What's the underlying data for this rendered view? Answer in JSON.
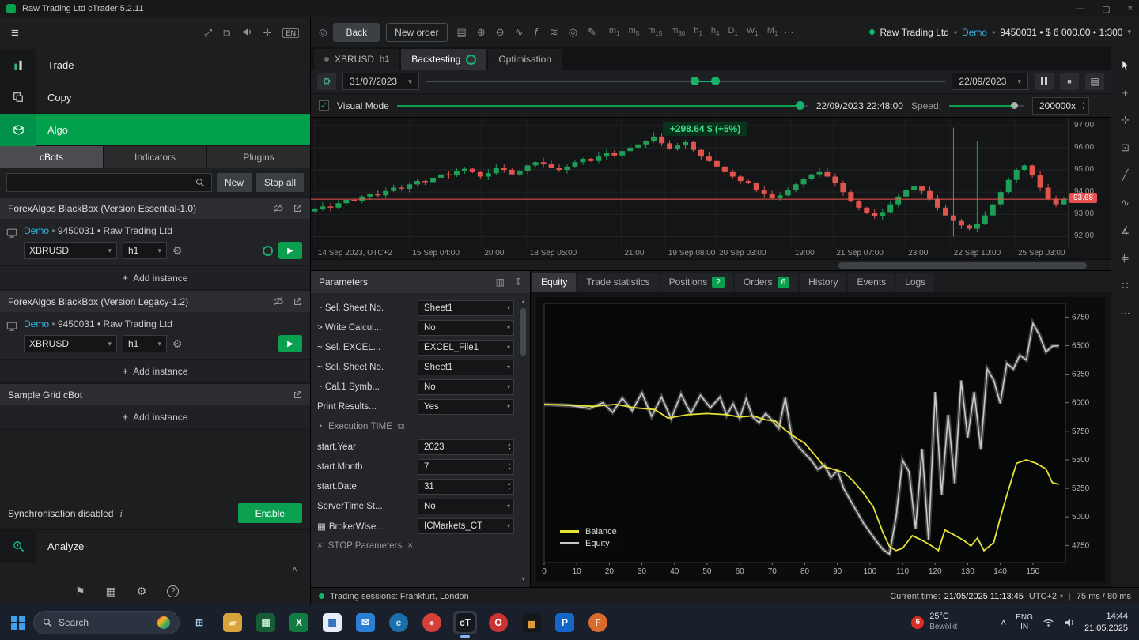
{
  "titlebar": {
    "title": "Raw Trading Ltd cTrader 5.2.11"
  },
  "sidebar": {
    "top_icons": [
      {
        "name": "fit-window-icon",
        "glyph": "⤢"
      },
      {
        "name": "windows-layout-icon",
        "glyph": "⧉"
      },
      {
        "name": "speaker-icon",
        "glyph": "speaker"
      },
      {
        "name": "widgets-icon",
        "glyph": "✛"
      },
      {
        "name": "language-badge",
        "glyph": "EN"
      }
    ],
    "nav": [
      {
        "label": "Trade"
      },
      {
        "label": "Copy"
      },
      {
        "label": "Algo"
      }
    ],
    "tabs": [
      {
        "label": "cBots",
        "active": true
      },
      {
        "label": "Indicators",
        "active": false
      },
      {
        "label": "Plugins",
        "active": false
      }
    ],
    "actions": {
      "new": "New",
      "stop_all": "Stop all"
    },
    "bots": [
      {
        "name": "ForexAlgos BlackBox (Version Essential-1.0)",
        "icons": [
          "cloud-off-icon",
          "share-icon"
        ],
        "instances": [
          {
            "account_type": "Demo",
            "account_rest": "9450031 • Raw Trading Ltd",
            "symbol": "XBRUSD",
            "timeframe": "h1",
            "running": true
          }
        ],
        "add_label": "Add instance"
      },
      {
        "name": "ForexAlgos BlackBox (Version Legacy-1.2)",
        "icons": [
          "cloud-off-icon",
          "share-icon"
        ],
        "instances": [
          {
            "account_type": "Demo",
            "account_rest": "9450031 • Raw Trading Ltd",
            "symbol": "XBRUSD",
            "timeframe": "h1",
            "running": false
          }
        ],
        "add_label": "Add instance"
      },
      {
        "name": "Sample Grid cBot",
        "icons": [
          "share-icon"
        ],
        "instances": [],
        "add_label": "Add instance"
      }
    ],
    "sync": {
      "label": "Synchronisation disabled",
      "button": "Enable"
    },
    "analyze": {
      "label": "Analyze"
    },
    "bottom_icons": [
      {
        "name": "alerts-icon",
        "glyph": "⚑"
      },
      {
        "name": "economic-calendar-icon",
        "glyph": "▦"
      },
      {
        "name": "settings-icon",
        "glyph": "⚙"
      },
      {
        "name": "help-icon",
        "glyph": "?"
      }
    ]
  },
  "toolbar": {
    "back": "Back",
    "new_order": "New order",
    "icons": [
      {
        "name": "chart-layout-icon",
        "glyph": "▤"
      },
      {
        "name": "zoom-in-icon",
        "glyph": "⊕"
      },
      {
        "name": "zoom-out-icon",
        "glyph": "⊖"
      },
      {
        "name": "tick-volume-icon",
        "glyph": "∿"
      },
      {
        "name": "indicators-icon",
        "glyph": "ƒ"
      },
      {
        "name": "objects-icon",
        "glyph": "≋"
      },
      {
        "name": "visibility-icon",
        "glyph": "◎"
      },
      {
        "name": "edit-chart-icon",
        "glyph": "✎"
      }
    ],
    "timeframes": [
      [
        "m",
        "1"
      ],
      [
        "m",
        "5"
      ],
      [
        "m",
        "15"
      ],
      [
        "m",
        "30"
      ],
      [
        "h",
        "1"
      ],
      [
        "h",
        "4"
      ],
      [
        "D",
        "1"
      ],
      [
        "W",
        "1"
      ],
      [
        "M",
        "1"
      ]
    ],
    "more": "⋯",
    "account": {
      "name": "Raw Trading Ltd",
      "type": "Demo",
      "rest": "9450031 • $ 6 000.00 • 1:300"
    }
  },
  "doc_tabs": {
    "symbol_tab": {
      "label": "XBRUSD",
      "tf": "h1"
    },
    "backtesting": "Backtesting",
    "optimisation": "Optimisation"
  },
  "backtest": {
    "start_date": "31/07/2023",
    "end_date": "22/09/2023",
    "progress_a": 51,
    "progress_b": 55
  },
  "visual": {
    "label": "Visual Mode",
    "checked": true,
    "datetime": "22/09/2023 22:48:00",
    "speed_label": "Speed:",
    "speed_value": "200000x",
    "position_pct": 97,
    "speed_pct": 82
  },
  "chart_data": [
    {
      "type": "candlestick",
      "symbol": "XBRUSD",
      "timeframe": "h1",
      "pl_label": "+298.64 $ (+5%)",
      "current_price": 93.68,
      "y_ticks": [
        97,
        96,
        95,
        94,
        93,
        92
      ],
      "x_labels": [
        {
          "t": "14 Sep 2023, UTC+2",
          "p": 0.005
        },
        {
          "t": "15 Sep 04:00",
          "p": 0.13
        },
        {
          "t": "20:00",
          "p": 0.225
        },
        {
          "t": "18 Sep 05:00",
          "p": 0.285
        },
        {
          "t": "21:00",
          "p": 0.41
        },
        {
          "t": "19 Sep 08:00",
          "p": 0.468
        },
        {
          "t": "20 Sep 03:00",
          "p": 0.535
        },
        {
          "t": "19:00",
          "p": 0.635
        },
        {
          "t": "21 Sep 07:00",
          "p": 0.69
        },
        {
          "t": "23:00",
          "p": 0.785
        },
        {
          "t": "22 Sep 10:00",
          "p": 0.845
        },
        {
          "t": "25 Sep 03:00",
          "p": 0.93
        }
      ],
      "closes": [
        93.25,
        93.35,
        93.3,
        93.5,
        93.65,
        93.6,
        93.8,
        93.9,
        93.85,
        94.05,
        94.2,
        94.15,
        94.35,
        94.5,
        94.45,
        94.65,
        94.8,
        94.75,
        94.95,
        95.05,
        94.9,
        94.7,
        94.85,
        95.1,
        95.0,
        94.8,
        94.95,
        95.2,
        95.35,
        95.25,
        95.1,
        95.0,
        95.15,
        95.35,
        95.5,
        95.4,
        95.6,
        95.75,
        95.65,
        95.85,
        96.0,
        96.15,
        96.3,
        96.5,
        96.2,
        95.95,
        96.1,
        96.25,
        95.9,
        95.6,
        95.4,
        95.15,
        94.9,
        94.7,
        94.5,
        94.4,
        94.1,
        93.9,
        93.75,
        93.85,
        94.1,
        94.35,
        94.6,
        94.8,
        94.9,
        94.7,
        94.4,
        94.0,
        93.6,
        93.3,
        93.05,
        92.9,
        93.1,
        93.45,
        93.8,
        94.1,
        94.25,
        94.05,
        93.7,
        93.3,
        92.95,
        92.7,
        92.5,
        92.35,
        92.55,
        92.95,
        93.45,
        94.0,
        94.55,
        95.0,
        95.2,
        94.75,
        94.2,
        93.7,
        93.45,
        93.68
      ],
      "scroll": {
        "left_pct": 66,
        "width_pct": 31
      }
    },
    {
      "type": "line",
      "title": "Equity",
      "xlim": [
        0,
        160
      ],
      "ylim": [
        4600,
        6870
      ],
      "y_ticks": [
        4750,
        5000,
        5250,
        5500,
        5750,
        6000,
        6250,
        6500,
        6750
      ],
      "x_ticks": [
        0,
        10,
        20,
        30,
        40,
        50,
        60,
        70,
        80,
        90,
        100,
        110,
        120,
        130,
        140,
        150
      ],
      "series": [
        {
          "name": "Balance",
          "color": "#e8e337",
          "points": [
            [
              0,
              5985
            ],
            [
              8,
              5980
            ],
            [
              15,
              5968
            ],
            [
              22,
              5985
            ],
            [
              28,
              5955
            ],
            [
              34,
              5940
            ],
            [
              38,
              5865
            ],
            [
              44,
              5895
            ],
            [
              50,
              5905
            ],
            [
              56,
              5895
            ],
            [
              60,
              5875
            ],
            [
              64,
              5885
            ],
            [
              68,
              5850
            ],
            [
              71,
              5840
            ],
            [
              74,
              5760
            ],
            [
              77,
              5700
            ],
            [
              80,
              5645
            ],
            [
              83,
              5545
            ],
            [
              86,
              5440
            ],
            [
              89,
              5415
            ],
            [
              92,
              5390
            ],
            [
              95,
              5310
            ],
            [
              98,
              5210
            ],
            [
              101,
              5090
            ],
            [
              104,
              4860
            ],
            [
              106,
              4740
            ],
            [
              108,
              4705
            ],
            [
              110,
              4725
            ],
            [
              113,
              4835
            ],
            [
              116,
              4795
            ],
            [
              119,
              4745
            ],
            [
              121,
              4705
            ],
            [
              123,
              4885
            ],
            [
              126,
              4840
            ],
            [
              129,
              4790
            ],
            [
              131,
              4745
            ],
            [
              133,
              4815
            ],
            [
              135,
              4705
            ],
            [
              138,
              4775
            ],
            [
              140,
              4990
            ],
            [
              142,
              5190
            ],
            [
              145,
              5470
            ],
            [
              148,
              5500
            ],
            [
              151,
              5470
            ],
            [
              154,
              5420
            ],
            [
              156,
              5300
            ],
            [
              158,
              5285
            ]
          ]
        },
        {
          "name": "Equity",
          "color": "#c8c8c8",
          "points": [
            [
              0,
              5985
            ],
            [
              8,
              5975
            ],
            [
              14,
              5950
            ],
            [
              18,
              6000
            ],
            [
              21,
              5915
            ],
            [
              24,
              6040
            ],
            [
              27,
              5930
            ],
            [
              30,
              6085
            ],
            [
              33,
              5880
            ],
            [
              36,
              6050
            ],
            [
              39,
              5860
            ],
            [
              42,
              6075
            ],
            [
              45,
              5905
            ],
            [
              48,
              6065
            ],
            [
              51,
              5955
            ],
            [
              54,
              6050
            ],
            [
              56,
              5890
            ],
            [
              58,
              5990
            ],
            [
              60,
              5865
            ],
            [
              62,
              6035
            ],
            [
              64,
              5875
            ],
            [
              66,
              5825
            ],
            [
              68,
              5905
            ],
            [
              70,
              5845
            ],
            [
              72,
              5775
            ],
            [
              74,
              6045
            ],
            [
              76,
              5695
            ],
            [
              78,
              5615
            ],
            [
              80,
              5555
            ],
            [
              82,
              5495
            ],
            [
              84,
              5415
            ],
            [
              86,
              5455
            ],
            [
              88,
              5345
            ],
            [
              90,
              5405
            ],
            [
              92,
              5245
            ],
            [
              94,
              5145
            ],
            [
              96,
              5045
            ],
            [
              98,
              4945
            ],
            [
              100,
              4865
            ],
            [
              102,
              4785
            ],
            [
              104,
              4715
            ],
            [
              106,
              4675
            ],
            [
              108,
              4995
            ],
            [
              110,
              5495
            ],
            [
              112,
              5395
            ],
            [
              114,
              4895
            ],
            [
              116,
              5595
            ],
            [
              118,
              4795
            ],
            [
              120,
              6095
            ],
            [
              122,
              5195
            ],
            [
              124,
              5895
            ],
            [
              126,
              5295
            ],
            [
              128,
              6195
            ],
            [
              130,
              5695
            ],
            [
              132,
              6095
            ],
            [
              134,
              5595
            ],
            [
              136,
              6295
            ],
            [
              138,
              6195
            ],
            [
              140,
              5995
            ],
            [
              142,
              6345
            ],
            [
              144,
              6295
            ],
            [
              146,
              6415
            ],
            [
              148,
              6375
            ],
            [
              150,
              6695
            ],
            [
              152,
              6595
            ],
            [
              154,
              6445
            ],
            [
              156,
              6495
            ],
            [
              158,
              6500
            ]
          ]
        }
      ]
    }
  ],
  "parameters": {
    "title": "Parameters",
    "rows": [
      {
        "type": "select",
        "label": "~ Sel. Sheet No.",
        "value": "Sheet1"
      },
      {
        "type": "select",
        "label": "> Write Calcul...",
        "value": "No"
      },
      {
        "type": "select",
        "label": "~ Sel. EXCEL...",
        "value": "EXCEL_File1"
      },
      {
        "type": "select",
        "label": "~ Sel. Sheet No.",
        "value": "Sheet1"
      },
      {
        "type": "select",
        "label": "~ Cal.1 Symb...",
        "value": "No"
      },
      {
        "type": "select",
        "label": "Print Results...",
        "value": "Yes"
      },
      {
        "type": "section",
        "label": "Execution TIME"
      },
      {
        "type": "stepper",
        "label": "start.Year",
        "value": "2023"
      },
      {
        "type": "stepper",
        "label": "start.Month",
        "value": "7"
      },
      {
        "type": "stepper",
        "label": "start.Date",
        "value": "31"
      },
      {
        "type": "select",
        "label": "ServerTime St...",
        "value": "No"
      },
      {
        "type": "select",
        "label": "BrokerWise...",
        "value": "ICMarkets_CT",
        "prefix_icon": true
      },
      {
        "type": "section2",
        "label": "STOP Parameters"
      }
    ]
  },
  "results": {
    "tabs": [
      {
        "label": "Equity",
        "active": true
      },
      {
        "label": "Trade statistics"
      },
      {
        "label": "Positions",
        "badge": "2"
      },
      {
        "label": "Orders",
        "badge": "6"
      },
      {
        "label": "History"
      },
      {
        "label": "Events"
      },
      {
        "label": "Logs"
      }
    ]
  },
  "right_tools": [
    {
      "name": "pointer-tool",
      "glyph": "cursor",
      "active": true
    },
    {
      "name": "crosshair-tool",
      "glyph": "+"
    },
    {
      "name": "dot-crosshair-tool",
      "glyph": "⊹"
    },
    {
      "name": "target-tool",
      "glyph": "⊡"
    },
    {
      "name": "trendline-tool",
      "glyph": "╱"
    },
    {
      "name": "wave-tool",
      "glyph": "∿"
    },
    {
      "name": "angle-tool",
      "glyph": "∡"
    },
    {
      "name": "fibonacci-tool",
      "glyph": "⋕"
    },
    {
      "name": "pattern-tool",
      "glyph": "∷"
    },
    {
      "name": "more-tools",
      "glyph": "⋯"
    }
  ],
  "statusbar": {
    "sessions": "Trading sessions: Frankfurt, London",
    "current_time_label": "Current time:",
    "current_time": "21/05/2025 11:13:45",
    "timezone": "UTC+2",
    "latency": "75 ms / 80 ms"
  },
  "taskbar": {
    "search_label": "Search",
    "icons": [
      {
        "name": "task-view",
        "glyph": "⊞",
        "bg": "",
        "fg": "#9fc8ea"
      },
      {
        "name": "file-explorer",
        "glyph": "▰",
        "bg": "#d9a33c",
        "fg": "#f7dfae"
      },
      {
        "name": "excel-workbook",
        "glyph": "▦",
        "bg": "#185c37",
        "fg": "#b9e6cd"
      },
      {
        "name": "excel",
        "glyph": "X",
        "bg": "#107c41",
        "fg": "#ffffff"
      },
      {
        "name": "calendar",
        "glyph": "▦",
        "bg": "#e8eef5",
        "fg": "#2b66b1"
      },
      {
        "name": "mail",
        "glyph": "✉",
        "bg": "#2a7fd4",
        "fg": "#ffffff"
      },
      {
        "name": "edge",
        "glyph": "e",
        "bg": "#1c6fa8",
        "fg": "#bfe8ff",
        "circle": true
      },
      {
        "name": "browser",
        "glyph": "●",
        "bg": "#d4403a",
        "fg": "#f7c5c2",
        "circle": true
      },
      {
        "name": "ctrader",
        "glyph": "cT",
        "bg": "#15181c",
        "fg": "#e8e8e8",
        "active": true
      },
      {
        "name": "opera",
        "glyph": "O",
        "bg": "#cc3333",
        "fg": "#ffffff",
        "circle": true
      },
      {
        "name": "stocks",
        "glyph": "▅",
        "bg": "#14171c",
        "fg": "#e09a3e"
      },
      {
        "name": "planner",
        "glyph": "P",
        "bg": "#1467c8",
        "fg": "#ffffff"
      },
      {
        "name": "firefox",
        "glyph": "F",
        "bg": "#d96c2c",
        "fg": "#ffe8c8",
        "circle": true
      }
    ],
    "weather": {
      "badge": "6",
      "temp": "25°C",
      "desc": "Bewölkt"
    },
    "lang_line1": "ENG",
    "lang_line2": "IN",
    "clock_time": "14:44",
    "clock_date": "21.05.2025"
  }
}
